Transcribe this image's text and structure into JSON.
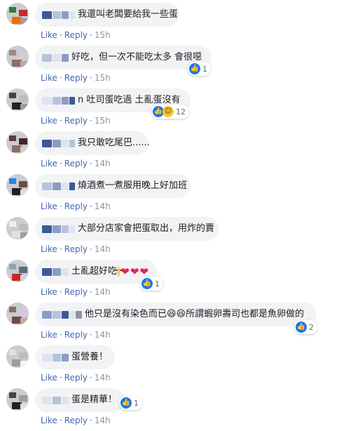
{
  "labels": {
    "like": "Like",
    "reply": "Reply",
    "dot": "·"
  },
  "colors": {
    "link": "#4267b2",
    "time": "#90949c",
    "bubble": "#f2f3f5",
    "like_blue": "#1877f2"
  },
  "comments": [
    {
      "text": "我還叫老闆要給我一些蛋",
      "time": "15h",
      "name_blocks": [
        "#3b5998",
        "#b7c3dd",
        "#8b9dc3",
        "#dfe3ee"
      ],
      "avatar_colors": [
        "#2e7d32",
        "#c62828",
        "#ef6c00",
        "#9e9e9e"
      ],
      "emojis": [],
      "hearts": 0,
      "reactions": null
    },
    {
      "text": "好吃，但一次不能吃太多 會很噁",
      "time": "15h",
      "name_blocks": [
        "#b7c3dd",
        "#dfe3ee",
        "#8b9dc3"
      ],
      "avatar_colors": [
        "#a1887f",
        "#d7ccc8",
        "#8d6e63",
        "#bcaaa4"
      ],
      "emojis": [],
      "hearts": 0,
      "reactions": {
        "icons": [
          "like-icon"
        ],
        "count": "1"
      }
    },
    {
      "text": "n 吐司蛋吃過 土亂蛋沒有",
      "time": "15h",
      "name_blocks": [
        "#dfe3ee",
        "#b7c3dd",
        "#8b9dc3",
        "#3b5998"
      ],
      "avatar_colors": [
        "#424242",
        "#bdbdbd",
        "#212121",
        "#9e9e9e"
      ],
      "emojis": [],
      "hearts": 0,
      "reactions": {
        "icons": [
          "like-icon",
          "haha-icon"
        ],
        "count": "12"
      }
    },
    {
      "text": "我只敢吃尾巴......",
      "time": "14h",
      "name_blocks": [
        "#3b5998",
        "#8b9dc3",
        "#dfe3ee",
        "#b7c3dd"
      ],
      "avatar_colors": [
        "#5d4037",
        "#3e2723",
        "#8d6e63",
        "#d7ccc8"
      ],
      "emojis": [],
      "hearts": 0,
      "reactions": null
    },
    {
      "text": "燒酒煮一煮服用晚上好加班",
      "time": "14h",
      "name_blocks": [
        "#b7c3dd",
        "#8b9dc3",
        "#dfe3ee",
        "#3b5998"
      ],
      "avatar_colors": [
        "#1e88e5",
        "#6d4c41",
        "#212121",
        "#e0e0e0"
      ],
      "emojis": [],
      "hearts": 0,
      "reactions": null
    },
    {
      "text": "大部分店家會把蛋取出，用炸的賣",
      "time": "14h",
      "name_blocks": [
        "#3b5998",
        "#8b9dc3",
        "#b7c3dd",
        "#dfe3ee"
      ],
      "avatar_colors": [
        "#eeeeee",
        "#bdbdbd",
        "#e0e0e0",
        "#9e9e9e"
      ],
      "emojis": [],
      "hearts": 0,
      "reactions": null
    },
    {
      "text": "土亂超好吃",
      "time": "14h",
      "name_blocks": [
        "#3b5998",
        "#8b9dc3",
        "#dfe3ee"
      ],
      "avatar_colors": [
        "#90a4ae",
        "#546e7a",
        "#c62828",
        "#cfd8dc"
      ],
      "emojis": [
        "smile-emoji"
      ],
      "hearts": 3,
      "reactions": {
        "icons": [
          "like-icon"
        ],
        "count": "1"
      }
    },
    {
      "text": "他只是沒有染色而已😆😆所謂蝦卵壽司也都是魚卵做的",
      "time": "14h",
      "name_blocks": [
        "#8b9dc3",
        "#b7c3dd",
        "#3b5998",
        "#dfe3ee",
        "#90949c"
      ],
      "avatar_colors": [
        "#8d6e63",
        "#e1bee7",
        "#6d4c41",
        "#bcaaa4"
      ],
      "emojis": [],
      "hearts": 0,
      "reactions": {
        "icons": [
          "like-icon"
        ],
        "count": "2"
      }
    },
    {
      "text": "蛋營養！",
      "time": "14h",
      "name_blocks": [
        "#dfe3ee",
        "#b7c3dd",
        "#8b9dc3"
      ],
      "avatar_colors": [
        "#e0e0e0",
        "#bdbdbd",
        "#9e9e9e",
        "#f5f5f5"
      ],
      "emojis": [],
      "hearts": 0,
      "reactions": null
    },
    {
      "text": "蛋是精華！",
      "time": "14h",
      "name_blocks": [
        "#dfe3ee",
        "#b7c3dd",
        "#dfe3ee"
      ],
      "avatar_colors": [
        "#424242",
        "#9e9e9e",
        "#212121",
        "#e0e0e0"
      ],
      "emojis": [],
      "hearts": 0,
      "reactions": {
        "icons": [
          "like-icon"
        ],
        "count": "1"
      }
    }
  ]
}
